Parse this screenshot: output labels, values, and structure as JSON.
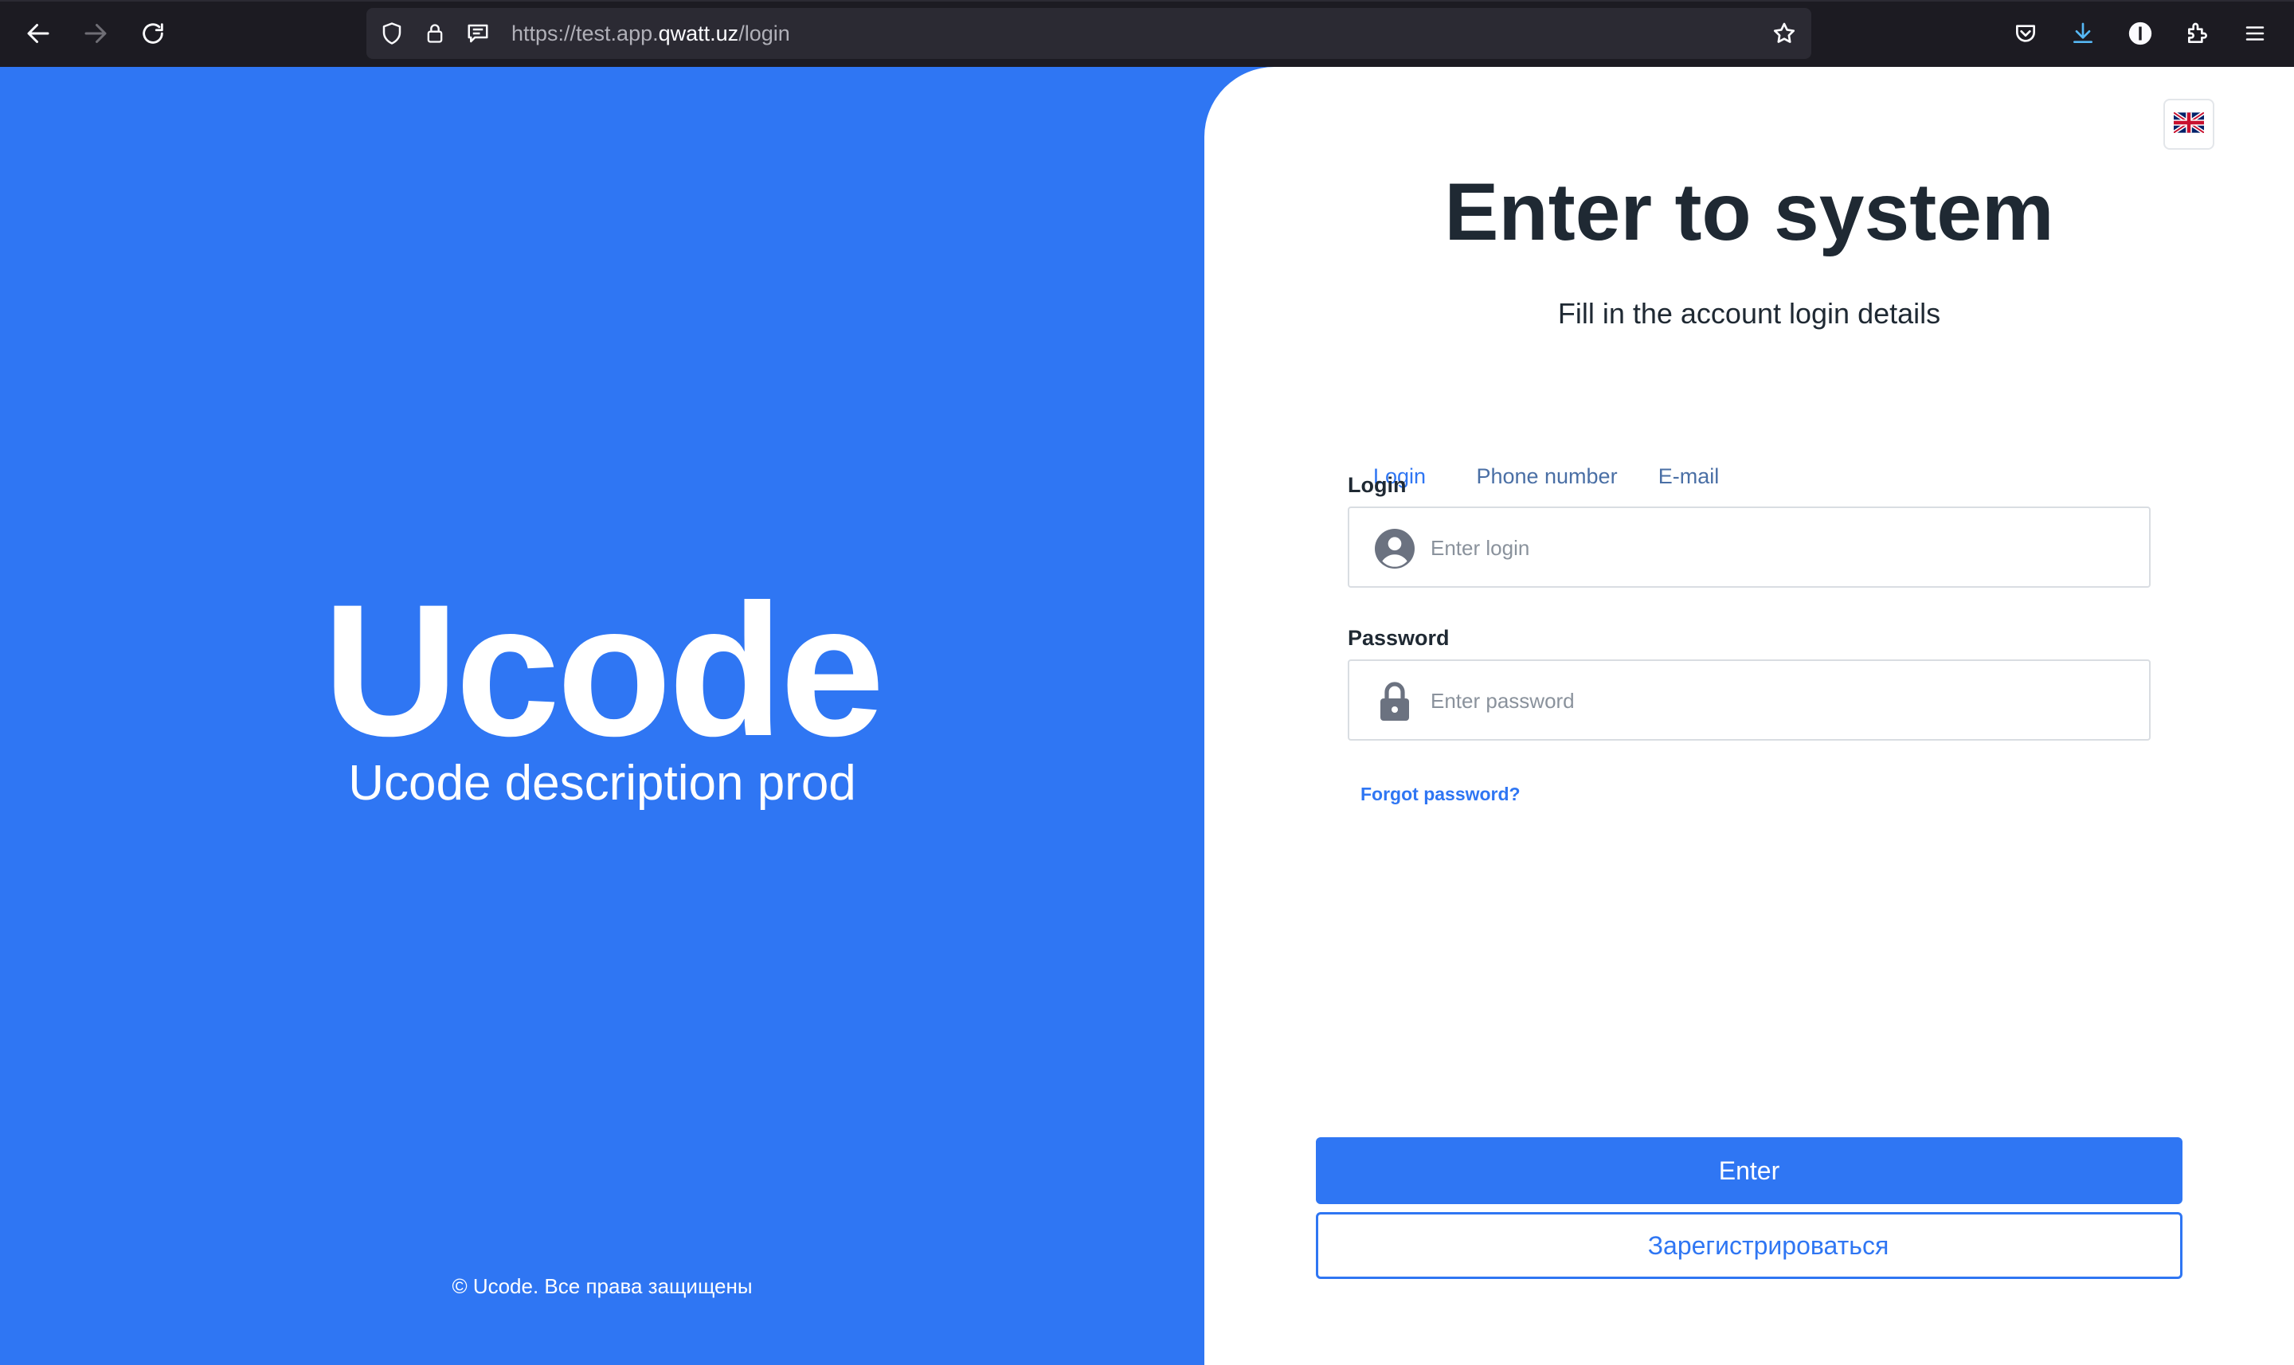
{
  "browser": {
    "url_scheme": "https://test.app.",
    "url_host": "qwatt.uz",
    "url_path": "/login",
    "icons": [
      "back-arrow-icon",
      "forward-arrow-icon",
      "reload-icon",
      "shield-icon",
      "lock-icon",
      "reader-view-icon",
      "bookmark-star-icon",
      "pocket-icon",
      "download-icon",
      "account-icon",
      "extensions-icon",
      "menu-icon"
    ]
  },
  "hero": {
    "brand": "Ucode",
    "description": "Ucode description prod",
    "copyright": "© Ucode. Все права защищены",
    "background_color": "#2f76f3"
  },
  "login": {
    "language_icon": "uk-flag-icon",
    "title": "Enter to system",
    "subtitle": "Fill in the account login details",
    "tabs": [
      {
        "label": "Login",
        "active": true
      },
      {
        "label": "Phone number",
        "active": false
      },
      {
        "label": "E-mail",
        "active": false
      }
    ],
    "login_field": {
      "label": "Login",
      "placeholder": "Enter login",
      "value": "",
      "icon": "user-avatar-icon"
    },
    "password_field": {
      "label": "Password",
      "placeholder": "Enter password",
      "value": "",
      "icon": "padlock-icon"
    },
    "forgot_password": "Forgot password?",
    "enter_button": "Enter",
    "register_button": "Зарегистрироваться",
    "accent_color": "#2f76f3"
  }
}
